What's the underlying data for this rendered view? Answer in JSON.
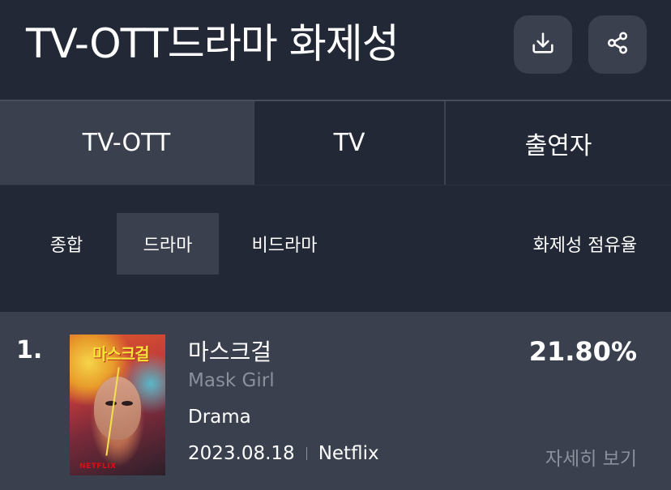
{
  "header": {
    "title": "TV-OTT드라마 화제성",
    "download_icon": "download-icon",
    "share_icon": "share-icon"
  },
  "tabs": [
    {
      "label": "TV-OTT",
      "active": true
    },
    {
      "label": "TV",
      "active": false
    },
    {
      "label": "출연자",
      "active": false
    }
  ],
  "subtabs": {
    "items": [
      {
        "label": "종합",
        "active": false
      },
      {
        "label": "드라마",
        "active": true
      },
      {
        "label": "비드라마",
        "active": false
      }
    ],
    "column_label": "화제성 점유율"
  },
  "ranking": [
    {
      "rank": "1.",
      "title_ko": "마스크걸",
      "title_en": "Mask Girl",
      "genre": "Drama",
      "date": "2023.08.18",
      "platform": "Netflix",
      "share": "21.80%",
      "detail_label": "자세히 보기",
      "poster": {
        "title_text": "마스크걸",
        "brand_text": "NETFLIX",
        "dominant_colors": [
          "#e05a2a",
          "#f4e23a",
          "#c03a3a"
        ]
      }
    }
  ],
  "colors": {
    "background": "#232836",
    "panel": "#3a404d",
    "text": "#ffffff",
    "muted": "#8a909c"
  }
}
